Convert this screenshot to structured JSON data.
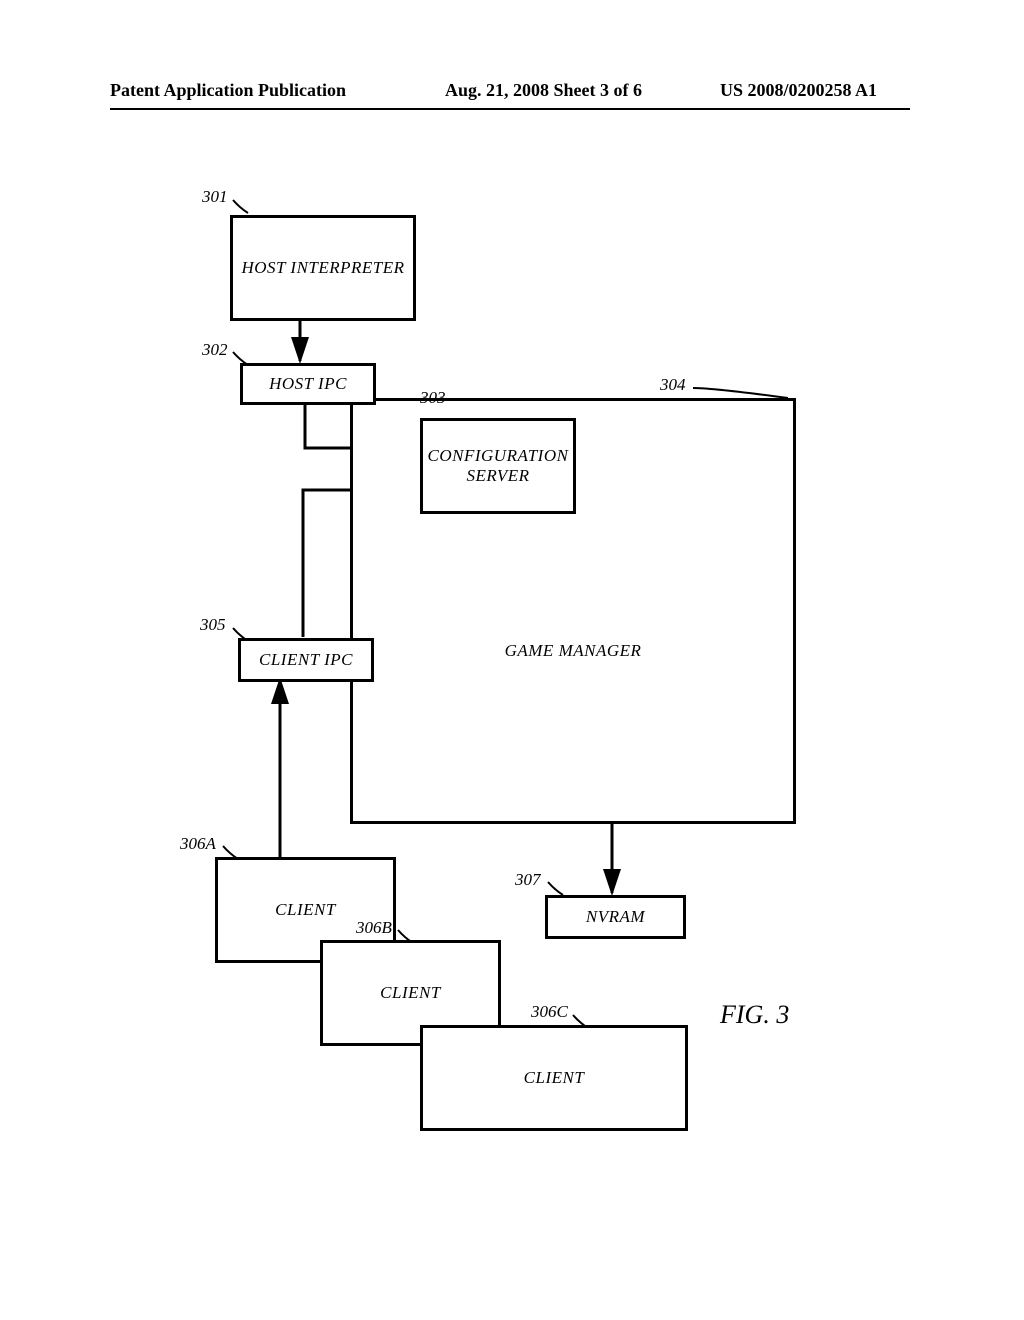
{
  "header": {
    "left": "Patent Application Publication",
    "center": "Aug. 21, 2008  Sheet 3 of 6",
    "right": "US 2008/0200258 A1"
  },
  "labels": {
    "n301": "301",
    "n302": "302",
    "n303": "303",
    "n304": "304",
    "n305": "305",
    "n306a": "306A",
    "n306b": "306B",
    "n306c": "306C",
    "n307": "307"
  },
  "boxes": {
    "host_interpreter": "HOST INTERPRETER",
    "host_ipc": "HOST IPC",
    "config_server": "CONFIGURATION\nSERVER",
    "game_manager": "GAME MANAGER",
    "client_ipc": "CLIENT IPC",
    "client_a": "CLIENT",
    "client_b": "CLIENT",
    "client_c": "CLIENT",
    "nvram": "NVRAM"
  },
  "figure": "FIG. 3"
}
